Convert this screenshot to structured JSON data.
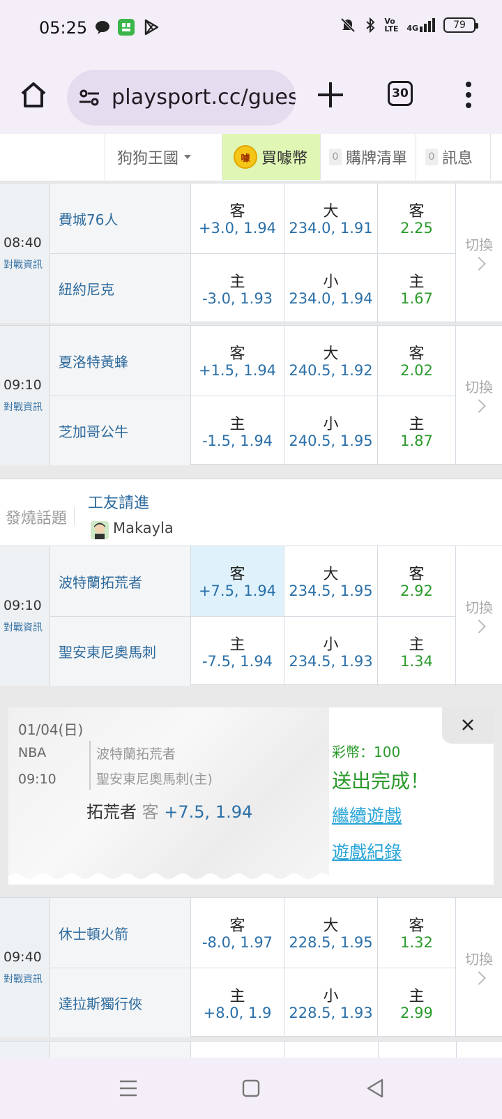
{
  "status_bar": {
    "time": "05:25",
    "battery": "79",
    "volte": "Vo LTE",
    "network": "4G",
    "icons": [
      "chat-icon",
      "wechat-icon",
      "play-store-icon",
      "mute-icon",
      "bluetooth-icon",
      "signal-icon",
      "battery-icon"
    ]
  },
  "browser": {
    "url": "playsport.cc/gues",
    "tab_count": "30",
    "icons": [
      "home-icon",
      "site-settings-icon",
      "new-tab-icon",
      "more-icon"
    ]
  },
  "site_nav": {
    "kingdom": "狗狗王國",
    "buy_coin": "買噱幣",
    "coin_badge": "噱",
    "cart_count": "0",
    "cart": "購牌清單",
    "msg_count": "0",
    "messages": "訊息"
  },
  "labels": {
    "away": "客",
    "home": "主",
    "over": "大",
    "under": "小",
    "switch": "切換",
    "match_info": "對戰資訊"
  },
  "games": [
    {
      "time": "08:40",
      "away_team": "費城76人",
      "home_team": "紐約尼克",
      "away_spread": "+3.0, 1.94",
      "home_spread": "-3.0, 1.93",
      "over": "234.0, 1.91",
      "under": "234.0, 1.94",
      "away_ml": "2.25",
      "home_ml": "1.67"
    },
    {
      "time": "09:10",
      "away_team": "夏洛特黃蜂",
      "home_team": "芝加哥公牛",
      "away_spread": "+1.5, 1.94",
      "home_spread": "-1.5, 1.94",
      "over": "240.5, 1.92",
      "under": "240.5, 1.95",
      "away_ml": "2.02",
      "home_ml": "1.87"
    },
    {
      "time": "09:10",
      "away_team": "波特蘭拓荒者",
      "home_team": "聖安東尼奧馬刺",
      "away_spread": "+7.5, 1.94",
      "home_spread": "-7.5, 1.94",
      "over": "234.5, 1.95",
      "under": "234.5, 1.93",
      "away_ml": "2.92",
      "home_ml": "1.34"
    },
    {
      "time": "09:40",
      "away_team": "休士頓火箭",
      "home_team": "達拉斯獨行俠",
      "away_spread": "-8.0, 1.97",
      "home_spread": "+8.0, 1.9",
      "over": "228.5, 1.95",
      "under": "228.5, 1.93",
      "away_ml": "1.32",
      "home_ml": "2.99"
    }
  ],
  "hot_topic": {
    "label": "發燒話題",
    "title": "工友請進",
    "user": "Makayla"
  },
  "confirmation": {
    "date": "01/04(日)",
    "league": "NBA",
    "time": "09:10",
    "team1": "波特蘭拓荒者",
    "team2": "聖安東尼奧馬刺(主)",
    "pick_team": "拓荒者",
    "pick_side": "客",
    "pick_odds": "+7.5, 1.94",
    "coins": "彩幣：100",
    "done": "送出完成！",
    "continue": "繼續遊戲",
    "history": "遊戲紀錄"
  },
  "colors": {
    "link_blue": "#2e6b9e",
    "odds_blue": "#2a6fa8",
    "odds_green": "#2a9a2a",
    "selected_bg": "#dff2fb",
    "coin_nav_bg": "#dff6b4"
  }
}
